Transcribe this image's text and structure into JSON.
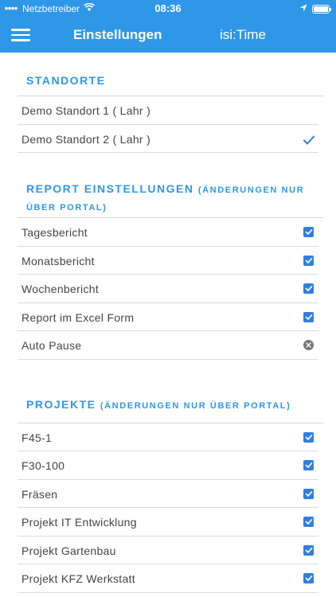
{
  "statusbar": {
    "carrier": "Netzbetreiber",
    "time": "08:36"
  },
  "navbar": {
    "title": "Einstellungen",
    "app_name": "isi:Time",
    "menu_icon": "hamburger-icon"
  },
  "sections": {
    "standorte": {
      "title": "STANDORTE",
      "items": [
        {
          "label": "Demo Standort 1 ( Lahr )",
          "selected": false
        },
        {
          "label": "Demo Standort 2 ( Lahr )",
          "selected": true
        }
      ]
    },
    "report": {
      "title": "REPORT EINSTELLUNGEN",
      "subtitle_a": "(ÄNDERUNGEN NUR",
      "subtitle_b": "ÜBER PORTAL)",
      "items": [
        {
          "label": "Tagesbericht",
          "state": "checked"
        },
        {
          "label": "Monatsbericht",
          "state": "checked"
        },
        {
          "label": "Wochenbericht",
          "state": "checked"
        },
        {
          "label": "Report im Excel Form",
          "state": "checked"
        },
        {
          "label": "Auto Pause",
          "state": "off"
        }
      ]
    },
    "projekte": {
      "title": "PROJEKTE",
      "subtitle": "(ÄNDERUNGEN NUR ÜBER PORTAL)",
      "items": [
        {
          "label": "F45-1",
          "state": "checked"
        },
        {
          "label": "F30-100",
          "state": "checked"
        },
        {
          "label": "Fräsen",
          "state": "checked"
        },
        {
          "label": "Projekt IT Entwicklung",
          "state": "checked"
        },
        {
          "label": "Projekt Gartenbau",
          "state": "checked"
        },
        {
          "label": "Projekt KFZ Werkstatt",
          "state": "checked"
        }
      ]
    }
  },
  "colors": {
    "accent": "#2f97e8",
    "checkbox": "#2f7fe0",
    "off": "#777777"
  }
}
